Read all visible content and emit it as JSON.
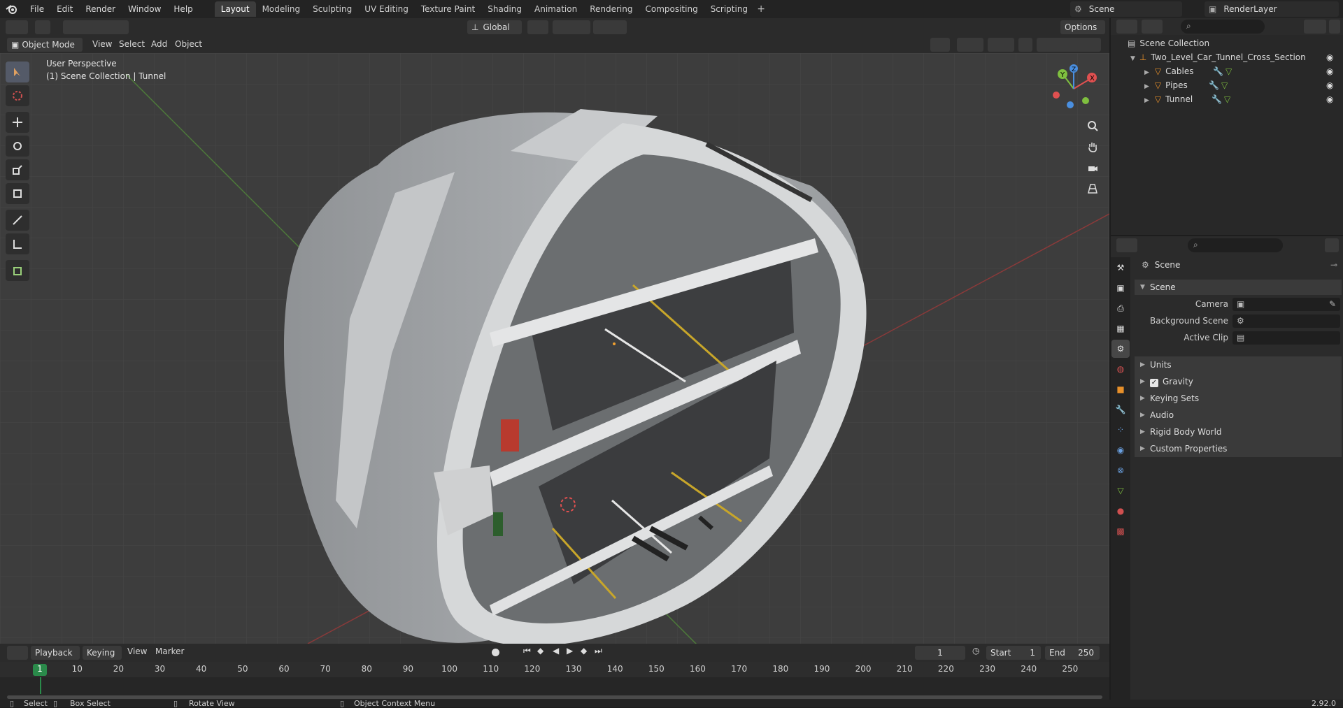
{
  "menubar": {
    "items": [
      "File",
      "Edit",
      "Render",
      "Window",
      "Help"
    ]
  },
  "workspaces": {
    "tabs": [
      "Layout",
      "Modeling",
      "Sculpting",
      "UV Editing",
      "Texture Paint",
      "Shading",
      "Animation",
      "Rendering",
      "Compositing",
      "Scripting"
    ],
    "active": "Layout",
    "add": "+"
  },
  "scene_selector": {
    "value": "Scene"
  },
  "viewlayer_selector": {
    "value": "RenderLayer"
  },
  "viewport_header": {
    "mode": "Object Mode",
    "menus": [
      "View",
      "Select",
      "Add",
      "Object"
    ],
    "orientation": "Global",
    "options": "Options"
  },
  "viewport": {
    "perspective_label": "User Perspective",
    "collection_label": "(1) Scene Collection | Tunnel",
    "gizmo_axes": [
      "X",
      "Y",
      "Z"
    ],
    "colors": {
      "x_axis": "#e05050",
      "y_axis": "#7fbf3f",
      "z_axis": "#4a8fe0"
    }
  },
  "toolbar": {
    "tools": [
      "select-box-icon",
      "cursor-icon",
      "move-icon",
      "rotate-icon",
      "scale-icon",
      "transform-icon",
      "annotate-icon",
      "measure-icon",
      "add-cube-icon"
    ]
  },
  "outliner": {
    "rows": [
      {
        "label": "Scene Collection",
        "level": 0
      },
      {
        "label": "Two_Level_Car_Tunnel_Cross_Section",
        "level": 1
      },
      {
        "label": "Cables",
        "level": 2
      },
      {
        "label": "Pipes",
        "level": 2
      },
      {
        "label": "Tunnel",
        "level": 2
      }
    ]
  },
  "properties": {
    "context": "Scene",
    "panel": "Scene",
    "fields": [
      {
        "label": "Camera"
      },
      {
        "label": "Background Scene"
      },
      {
        "label": "Active Clip"
      }
    ],
    "subpanels": [
      "Units",
      "Gravity",
      "Keying Sets",
      "Audio",
      "Rigid Body World",
      "Custom Properties"
    ],
    "gravity_checked": true
  },
  "timeline": {
    "menus": [
      "Playback",
      "Keying",
      "View",
      "Marker"
    ],
    "current_frame": "1",
    "start_label": "Start",
    "start": "1",
    "end_label": "End",
    "end": "250",
    "ruler": [
      "1",
      "10",
      "20",
      "30",
      "40",
      "50",
      "60",
      "70",
      "80",
      "90",
      "100",
      "110",
      "120",
      "130",
      "140",
      "150",
      "160",
      "170",
      "180",
      "190",
      "200",
      "210",
      "220",
      "230",
      "240",
      "250"
    ]
  },
  "statusbar": {
    "select": "Select",
    "box_select": "Box Select",
    "rotate_view": "Rotate View",
    "context_menu": "Object Context Menu",
    "version": "2.92.0"
  }
}
